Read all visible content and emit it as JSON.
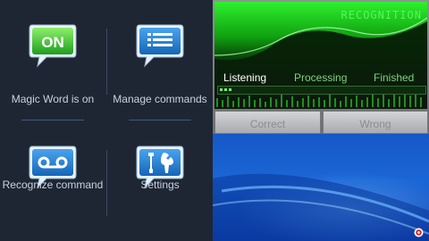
{
  "menu": {
    "items": [
      {
        "label": "Magic Word is on",
        "icon": "on-badge-icon",
        "badge": "ON"
      },
      {
        "label": "Manage commands",
        "icon": "list-icon"
      },
      {
        "label": "Recognize command",
        "icon": "voicemail-icon"
      },
      {
        "label": "Settings",
        "icon": "tools-icon"
      }
    ]
  },
  "widget": {
    "title": "RECOGNITION",
    "states": [
      "Listening",
      "Processing",
      "Finished"
    ],
    "active_state": "Listening",
    "buttons": {
      "correct": "Correct",
      "wrong": "Wrong"
    }
  },
  "colors": {
    "accent_green": "#58f558",
    "icon_blue": "#1a7bd0",
    "on_green": "#2fbf28",
    "menu_bg": "#1e2634"
  }
}
